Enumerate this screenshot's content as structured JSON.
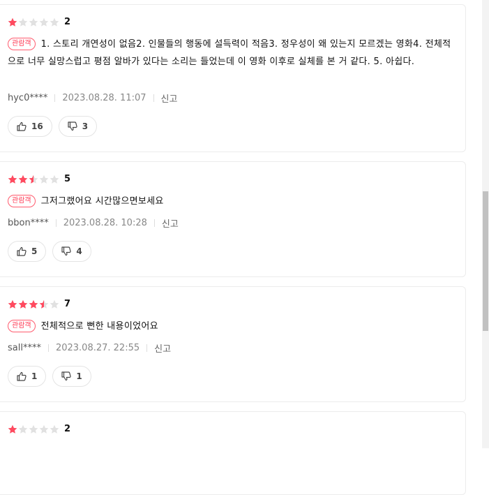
{
  "badge_label": "관람객",
  "report_label": "신고",
  "colors": {
    "star_filled": "#ff4a5f",
    "star_empty": "#e1e1e1",
    "badge": "#ff3b55"
  },
  "icons": {
    "like": "thumbs-up-icon",
    "dislike": "thumbs-down-icon"
  },
  "reviews": [
    {
      "stars": 1,
      "score": "2",
      "text": "1. 스토리 개연성이 없음2. 인물들의 행동에 설득력이 적음3. 정우성이 왜 있는지 모르겠는 영화4. 전체적으로 너무 실망스럽고 평점 알바가 있다는 소리는 들었는데 이 영화 이후로 실체를 본 거 같다. 5. 아쉽다.",
      "user": "hyc0****",
      "date": "2023.08.28. 11:07",
      "likes": "16",
      "dislikes": "3"
    },
    {
      "stars": 2.5,
      "score": "5",
      "text": "그저그랬어요 시간많으면보세요",
      "user": "bbon****",
      "date": "2023.08.28. 10:28",
      "likes": "5",
      "dislikes": "4"
    },
    {
      "stars": 3.5,
      "score": "7",
      "text": "전체적으로 뻔한 내용이었어요",
      "user": "sall****",
      "date": "2023.08.27. 22:55",
      "likes": "1",
      "dislikes": "1"
    },
    {
      "stars": 1,
      "score": "2",
      "text": "",
      "user": "",
      "date": "",
      "likes": "",
      "dislikes": ""
    }
  ]
}
